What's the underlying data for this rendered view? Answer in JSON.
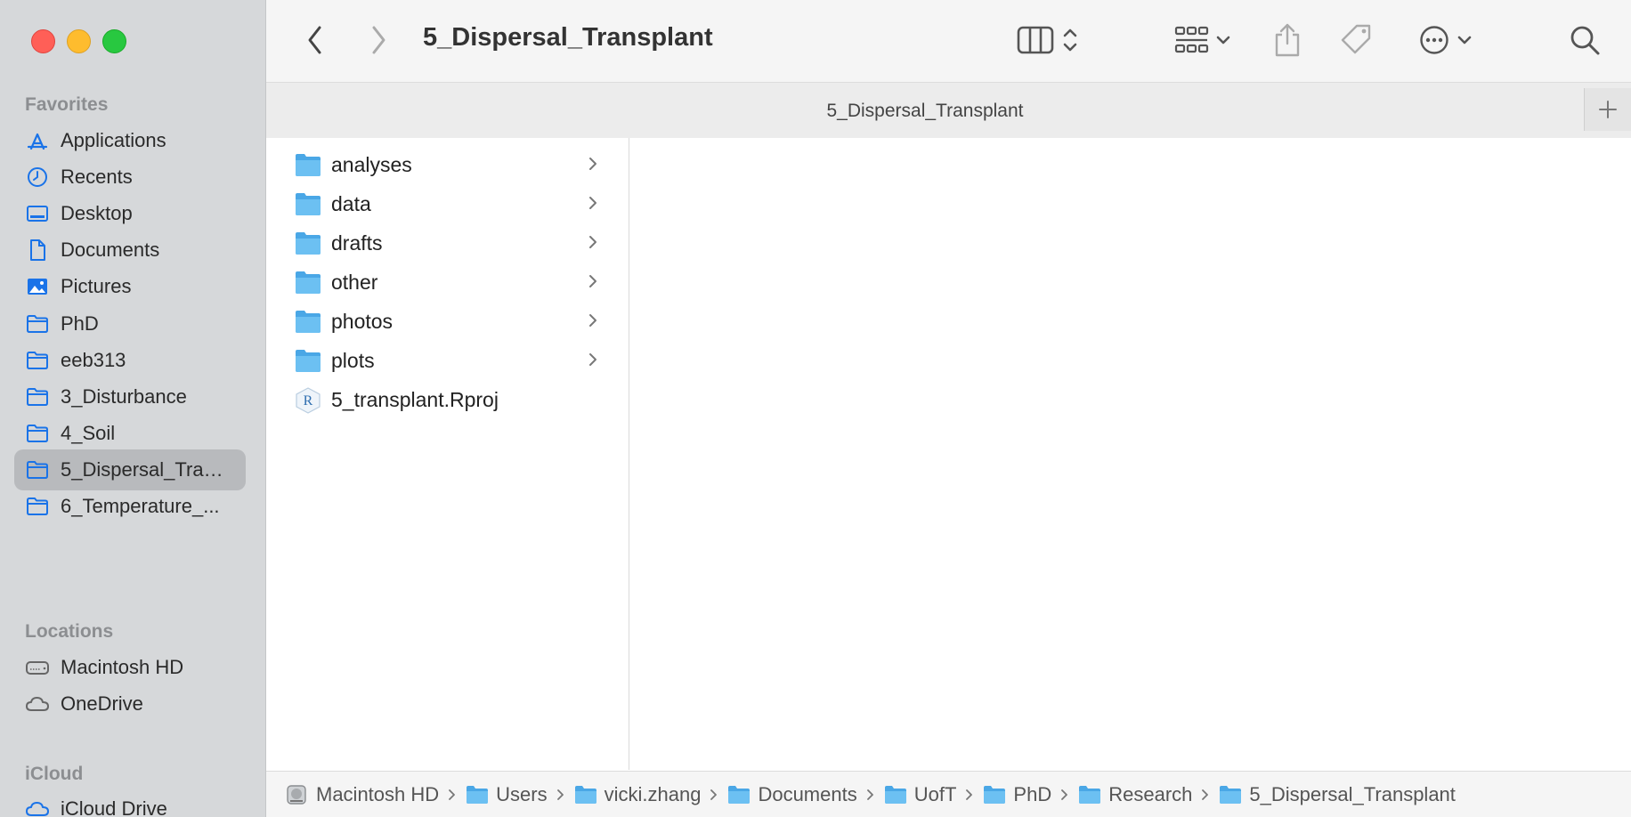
{
  "window": {
    "title": "5_Dispersal_Transplant",
    "tab_title": "5_Dispersal_Transplant"
  },
  "sidebar": {
    "favorites_heading": "Favorites",
    "favorites": [
      {
        "label": "Applications",
        "icon": "applications-icon"
      },
      {
        "label": "Recents",
        "icon": "clock-icon"
      },
      {
        "label": "Desktop",
        "icon": "desktop-icon"
      },
      {
        "label": "Documents",
        "icon": "document-icon"
      },
      {
        "label": "Pictures",
        "icon": "photo-icon"
      },
      {
        "label": "PhD",
        "icon": "folder-icon"
      },
      {
        "label": "eeb313",
        "icon": "folder-icon"
      },
      {
        "label": "3_Disturbance",
        "icon": "folder-icon"
      },
      {
        "label": "4_Soil",
        "icon": "folder-icon"
      },
      {
        "label": "5_Dispersal_Transplant",
        "icon": "folder-icon",
        "selected": true
      },
      {
        "label": "6_Temperature_...",
        "icon": "folder-icon"
      }
    ],
    "locations_heading": "Locations",
    "locations": [
      {
        "label": "Macintosh HD",
        "icon": "hard-drive-icon"
      },
      {
        "label": "OneDrive",
        "icon": "cloud-icon"
      }
    ],
    "icloud_heading": "iCloud",
    "icloud": [
      {
        "label": "iCloud Drive",
        "icon": "cloud-icon"
      }
    ]
  },
  "column": {
    "items": [
      {
        "name": "analyses",
        "type": "folder"
      },
      {
        "name": "data",
        "type": "folder"
      },
      {
        "name": "drafts",
        "type": "folder"
      },
      {
        "name": "other",
        "type": "folder"
      },
      {
        "name": "photos",
        "type": "folder"
      },
      {
        "name": "plots",
        "type": "folder"
      },
      {
        "name": "5_transplant.Rproj",
        "type": "rproj"
      }
    ]
  },
  "pathbar": {
    "crumbs": [
      {
        "label": "Macintosh HD",
        "icon": "hard-drive-icon"
      },
      {
        "label": "Users",
        "icon": "folder-icon"
      },
      {
        "label": "vicki.zhang",
        "icon": "folder-icon"
      },
      {
        "label": "Documents",
        "icon": "folder-icon"
      },
      {
        "label": "UofT",
        "icon": "folder-icon"
      },
      {
        "label": "PhD",
        "icon": "folder-icon"
      },
      {
        "label": "Research",
        "icon": "folder-icon"
      },
      {
        "label": "5_Dispersal_Transplant",
        "icon": "folder-icon"
      }
    ]
  },
  "colors": {
    "accent": "#1a73e8",
    "folder": "#5ab4ec",
    "selected": "#b8babd"
  }
}
